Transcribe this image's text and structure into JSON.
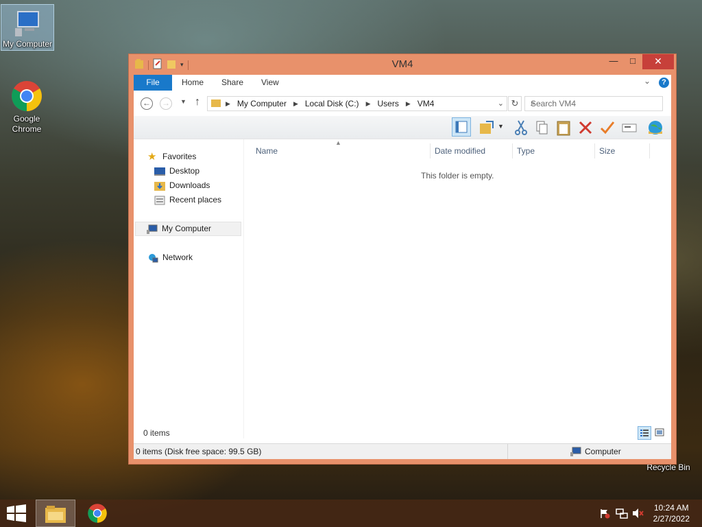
{
  "desktop": {
    "icons": [
      {
        "label": "My Computer"
      },
      {
        "label": "Google Chrome"
      },
      {
        "label": "Recycle Bin"
      }
    ]
  },
  "window": {
    "title": "VM4",
    "controls": {
      "minimize": "—",
      "maximize": "□",
      "close": "✕"
    },
    "ribbon_tabs": [
      "File",
      "Home",
      "Share",
      "View"
    ],
    "address": {
      "crumbs": [
        "My Computer",
        "Local Disk (C:)",
        "Users",
        "VM4"
      ]
    },
    "search": {
      "placeholder": "Search VM4"
    },
    "nav": {
      "favorites": "Favorites",
      "items": [
        "Desktop",
        "Downloads",
        "Recent places"
      ],
      "computer": "My Computer",
      "network": "Network"
    },
    "columns": [
      "Name",
      "Date modified",
      "Type",
      "Size"
    ],
    "empty_message": "This folder is empty.",
    "status": {
      "items": "0 items",
      "detail": "0 items (Disk free space: 99.5 GB)",
      "location": "Computer"
    }
  },
  "taskbar": {
    "time": "10:24 AM",
    "date": "2/27/2022"
  },
  "colors": {
    "accent": "#1979ca",
    "window_frame": "#e8916b",
    "close_button": "#c7403a"
  }
}
